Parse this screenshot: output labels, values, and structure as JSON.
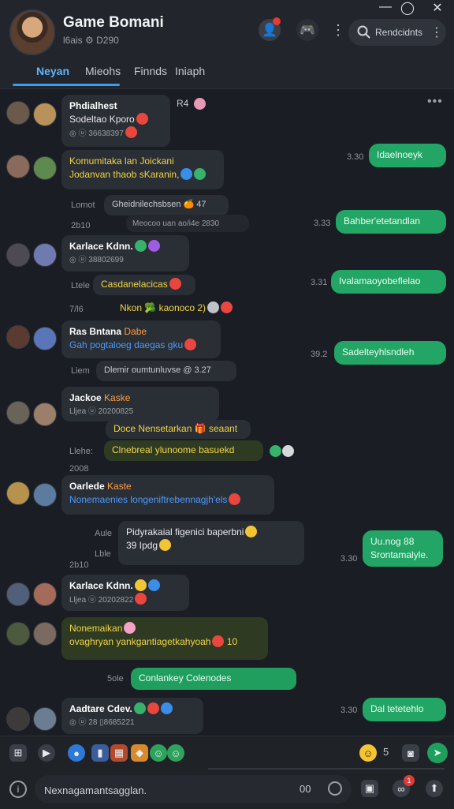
{
  "window": {
    "minimize": "—",
    "maximize": "◯",
    "close": "✕"
  },
  "header": {
    "title": "Game Bomani",
    "subtitle": "l6ais  ⚙  D290",
    "search_label": "Rendcidnts"
  },
  "tabs": [
    "Neyan",
    "Mieohs",
    "Finnds",
    "Iniaph"
  ],
  "messages": {
    "m1": {
      "name": "Phdialhest",
      "line2": "Sodeltao Kporo",
      "meta": "◎ ⓤ 36638397",
      "side": "R4"
    },
    "m2": {
      "line1": "Komumitaka lan Joickani",
      "line2": "Jodanvan thaob sKaranin,",
      "time": "3.30",
      "out": "Idaelnoeyk"
    },
    "m3": {
      "label": "Lomot",
      "text": "Gheidnilechsbsen  🍊 47"
    },
    "m4": {
      "sub": "Meocoo uan ao/i4e 2830",
      "time": "3.33",
      "out": "Bahber'etetandlan",
      "label": "2b10"
    },
    "m5": {
      "name": "Karlace Kdnn.",
      "meta": "◎ ⓤ 38802699",
      "label": "Ltele",
      "bubble": "Casdanelacicas",
      "time": "3.31",
      "out": "Ivalamaoyobeflelao"
    },
    "m6": {
      "label": "7/l6",
      "text": "Nkon  🥦 kaonoco 2)"
    },
    "m7": {
      "name": "Ras Bntana",
      "name2": "Dabe",
      "line2": "Gah pogtaloeg daegas gku",
      "time": "39.2",
      "out": "Sadelteyhlsndleh"
    },
    "m8": {
      "label": "Liem",
      "text": "Dlemir oumtunluvse @ 3.27"
    },
    "m9": {
      "name": "Jackoe",
      "name2": "Kaske",
      "meta": "Lljea  ⓤ 20200825",
      "extra": "Doce Nensetarkan 🎁 seaant"
    },
    "m10": {
      "label": "Llehe:",
      "text": "Clnebreal ylunoome basuekd",
      "label2": "2008"
    },
    "m11": {
      "name": "Oarlede",
      "name2": "Kaste",
      "line2": "Nonemaenies longeniftrebennagjh'els"
    },
    "m12": {
      "label": "Aule",
      "line1": "Pidyrakaial figenici baperbni",
      "line2": "39 Ipdg",
      "label2": "Lble",
      "out1": "Uu.nog 88",
      "out2": "Srontamalyle.",
      "time": "3.30",
      "label3": "2b10"
    },
    "m13": {
      "name": "Karlace Kdnn.",
      "meta": "Lljea  ⓤ 20202822"
    },
    "m14": {
      "line1": "Nonemaikan",
      "line2": "ovaghryan yankgantiagetkahyoah",
      "suffix": "10"
    },
    "m15": {
      "label": "5ole",
      "text": "Conlankey Colenodes"
    },
    "m16": {
      "name": "Aadtare Cdev.",
      "meta": "◎ ⓤ 28 ▯8685221",
      "time": "3.30",
      "out": "Dal tetetehlo"
    }
  },
  "composer": {
    "placeholder": "Nexnagamantsagglan.",
    "counter": "00",
    "emoji_count": "5",
    "badge": "1"
  },
  "colors": {
    "accent": "#3d9bf2",
    "outgoing": "#22a565",
    "background": "#1a1d23"
  }
}
